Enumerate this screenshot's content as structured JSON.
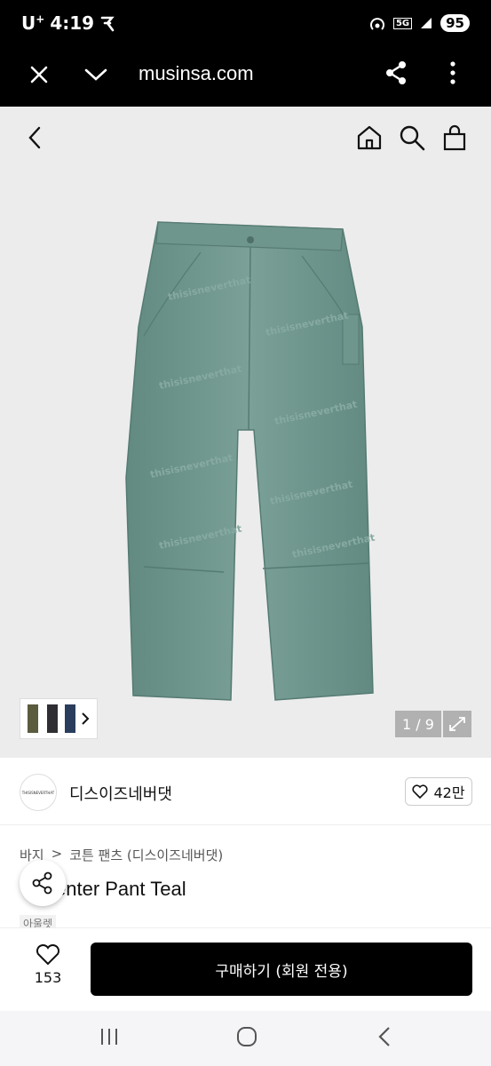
{
  "status": {
    "carrier": "U",
    "carrier_sup": "+",
    "time": "4:19",
    "network": "5G",
    "battery": "95"
  },
  "browser": {
    "url": "musinsa.com"
  },
  "gallery": {
    "counter": "1 / 9"
  },
  "brand": {
    "logo_text": "THISISNEVERTHAT",
    "name": "디스이즈네버댓",
    "likes": "42만"
  },
  "breadcrumb": {
    "category": "바지",
    "separator": ">",
    "subcategory": "코튼 팬츠 (디스이즈네버댓)"
  },
  "product": {
    "title": "enter Pant Teal",
    "tag": "아울렛",
    "color": "#6f968d"
  },
  "bottom": {
    "like_count": "153",
    "buy_label": "구매하기 (회원 전용)"
  }
}
